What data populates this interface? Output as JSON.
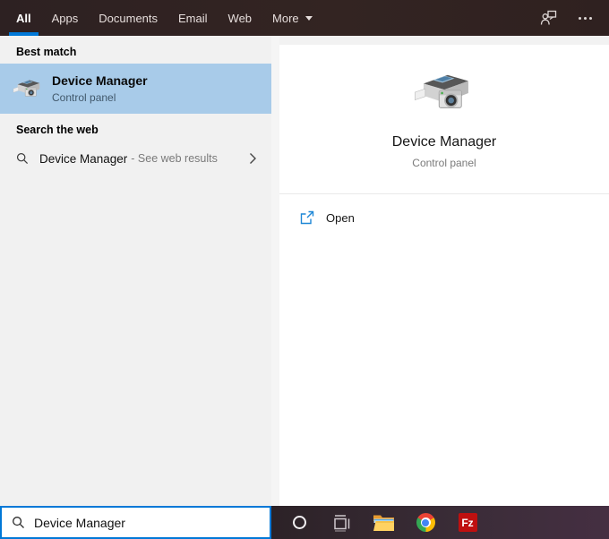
{
  "colors": {
    "accent": "#0078d7",
    "best_match_highlight": "#a8cbe9",
    "header_bg": "#2f2322",
    "taskbar_bg": "#3a2c37",
    "left_panel_bg": "#f1f1f1",
    "filezilla_red": "#bf1010"
  },
  "header": {
    "tabs": [
      {
        "label": "All",
        "active": true
      },
      {
        "label": "Apps",
        "active": false
      },
      {
        "label": "Documents",
        "active": false
      },
      {
        "label": "Email",
        "active": false
      },
      {
        "label": "Web",
        "active": false
      },
      {
        "label": "More",
        "active": false,
        "has_dropdown": true
      }
    ],
    "icons": [
      "user-options-icon",
      "ellipsis-icon"
    ]
  },
  "left_panel": {
    "best_match": {
      "section_label": "Best match",
      "result": {
        "title": "Device Manager",
        "subtitle": "Control panel",
        "icon": "device-manager-icon"
      }
    },
    "search_web": {
      "section_label": "Search the web",
      "result": {
        "query": "Device Manager",
        "suffix": "- See web results",
        "icon": "search-icon",
        "chevron": "chevron-right-icon"
      }
    }
  },
  "right_panel": {
    "icon": "device-manager-icon",
    "title": "Device Manager",
    "subtitle": "Control panel",
    "actions": [
      {
        "label": "Open",
        "icon": "open-external-icon"
      }
    ]
  },
  "search_bar": {
    "value": "Device Manager",
    "icon": "search-icon"
  },
  "taskbar": {
    "icons": [
      "cortana-icon",
      "task-view-icon",
      "file-explorer-icon",
      "chrome-icon",
      "filezilla-icon"
    ],
    "filezilla_label": "Fz"
  }
}
